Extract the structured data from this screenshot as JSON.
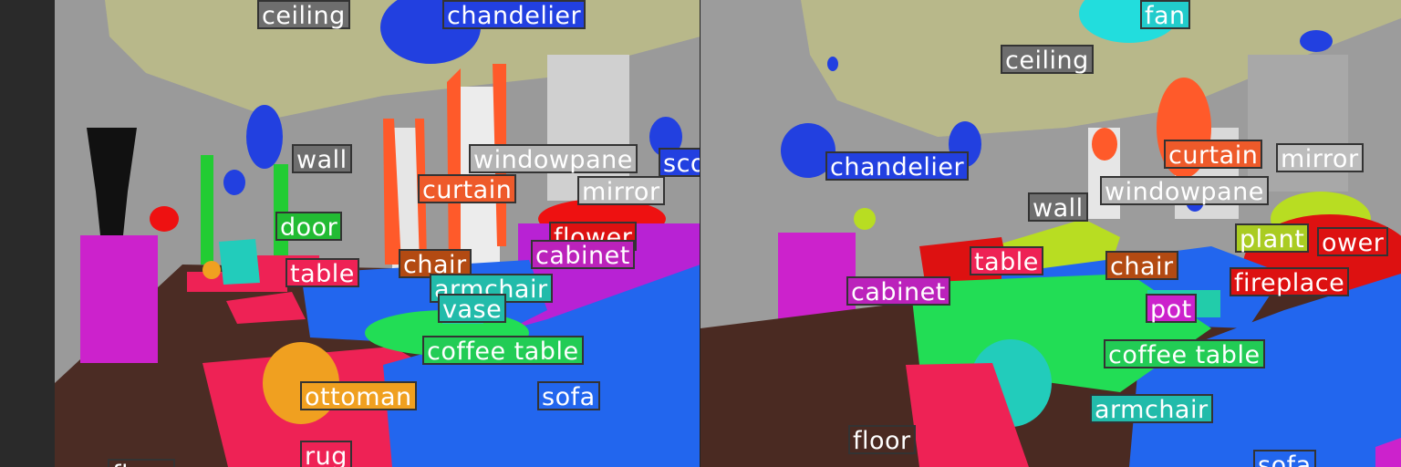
{
  "colors": {
    "ceiling": "#b9b98a",
    "wall": "#8c8c8c",
    "chandelier": "#2240e0",
    "windowpane": "#e6e6e6",
    "curtain": "#ff5a2a",
    "mirror": "#c8c8c8",
    "door": "#22cc33",
    "flower": "#ee1111",
    "cabinet": "#cc22cc",
    "table": "#ee2255",
    "chair": "#b34a12",
    "armchair": "#22ccbb",
    "vase": "#22ccaa",
    "coffee_table": "#22dd55",
    "ottoman": "#f0a020",
    "sofa": "#2266ee",
    "rug": "#ee2255",
    "floor": "#4a2a22",
    "fan": "#22dddd",
    "plant": "#b8dd22",
    "fireplace": "#dd1111",
    "pot": "#cc22cc",
    "sconce": "#2240e0"
  },
  "panels": [
    {
      "id": "left",
      "labels": [
        {
          "key": "ceiling",
          "text": "ceiling",
          "color": "#6e6e6e"
        },
        {
          "key": "chandelier",
          "text": "chandelier",
          "color": "#2240e0"
        },
        {
          "key": "wall",
          "text": "wall",
          "color": "#6e6e6e"
        },
        {
          "key": "windowpane",
          "text": "windowpane",
          "color": "#b4b4b4"
        },
        {
          "key": "sconce",
          "text": "sco",
          "color": "#2240e0"
        },
        {
          "key": "curtain",
          "text": "curtain",
          "color": "#ee5a2a"
        },
        {
          "key": "mirror",
          "text": "mirror",
          "color": "#bdbdbd"
        },
        {
          "key": "door",
          "text": "door",
          "color": "#22bb33"
        },
        {
          "key": "flower",
          "text": "flower",
          "color": "#dd1111"
        },
        {
          "key": "cabinet",
          "text": "cabinet",
          "color": "#bb22bb"
        },
        {
          "key": "table",
          "text": "table",
          "color": "#ee2255"
        },
        {
          "key": "chair",
          "text": "chair",
          "color": "#b34a12"
        },
        {
          "key": "armchair",
          "text": "armchair",
          "color": "#22bbaa"
        },
        {
          "key": "vase",
          "text": "vase",
          "color": "#22bbaa"
        },
        {
          "key": "coffee_table",
          "text": "coffee table",
          "color": "#22cc55"
        },
        {
          "key": "ottoman",
          "text": "ottoman",
          "color": "#f0a020"
        },
        {
          "key": "sofa",
          "text": "sofa",
          "color": "#2266ee"
        },
        {
          "key": "rug",
          "text": "rug",
          "color": "#ee2255"
        },
        {
          "key": "floor",
          "text": "floor",
          "color": "#4a2a22"
        }
      ]
    },
    {
      "id": "right",
      "labels": [
        {
          "key": "fan",
          "text": "fan",
          "color": "#22cccc"
        },
        {
          "key": "ceiling",
          "text": "ceiling",
          "color": "#6e6e6e"
        },
        {
          "key": "chandelier",
          "text": "chandelier",
          "color": "#2240e0"
        },
        {
          "key": "curtain",
          "text": "curtain",
          "color": "#ee5a2a"
        },
        {
          "key": "mirror",
          "text": "mirror",
          "color": "#bdbdbd"
        },
        {
          "key": "wall",
          "text": "wall",
          "color": "#6e6e6e"
        },
        {
          "key": "windowpane",
          "text": "windowpane",
          "color": "#b4b4b4"
        },
        {
          "key": "plant",
          "text": "plant",
          "color": "#aacc22"
        },
        {
          "key": "flower",
          "text": "ower",
          "color": "#dd1111"
        },
        {
          "key": "table",
          "text": "table",
          "color": "#ee2255"
        },
        {
          "key": "chair",
          "text": "chair",
          "color": "#b34a12"
        },
        {
          "key": "fireplace",
          "text": "fireplace",
          "color": "#dd1111"
        },
        {
          "key": "cabinet",
          "text": "cabinet",
          "color": "#bb22bb"
        },
        {
          "key": "pot",
          "text": "pot",
          "color": "#cc22cc"
        },
        {
          "key": "coffee_table",
          "text": "coffee table",
          "color": "#22cc55"
        },
        {
          "key": "armchair",
          "text": "armchair",
          "color": "#22bbaa"
        },
        {
          "key": "floor",
          "text": "floor",
          "color": "#4a2a22"
        },
        {
          "key": "sofa",
          "text": "sofa",
          "color": "#2266ee"
        }
      ]
    }
  ]
}
